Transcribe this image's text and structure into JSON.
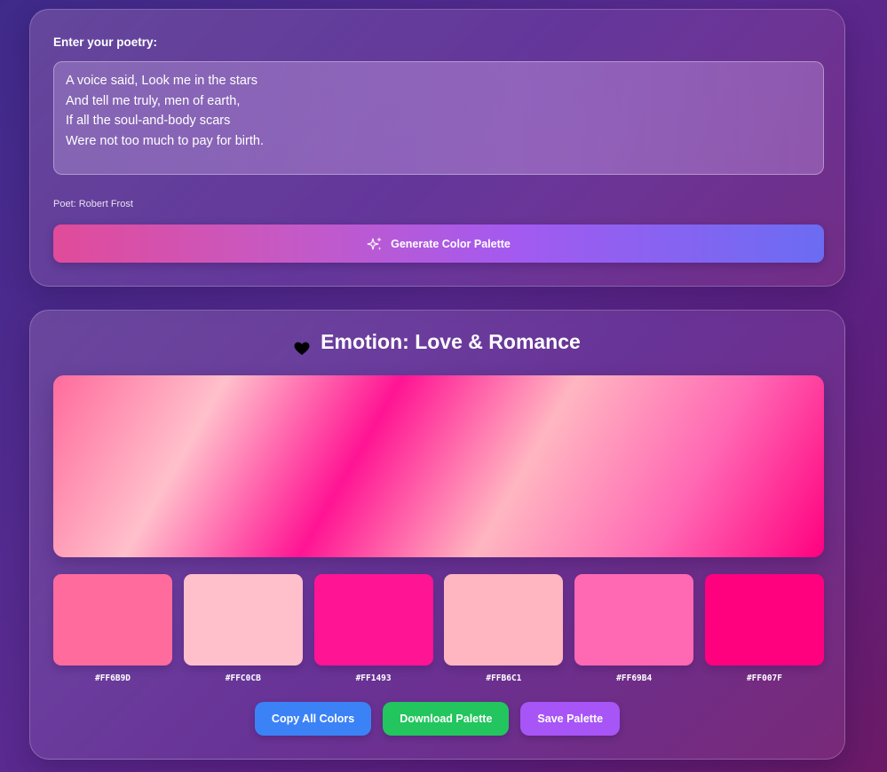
{
  "input": {
    "label": "Enter your poetry:",
    "poem_lines": [
      "A voice said, Look me in the stars",
      "And tell me truly, men of earth,",
      "If all the soul-and-body scars",
      "Were not too much to pay for birth."
    ],
    "poet": "Poet: Robert Frost",
    "generate_label": "Generate Color Palette",
    "generate_icon": "sparkles-icon"
  },
  "result": {
    "emotion_icon": "heart-icon",
    "emotion_title": "Emotion: Love & Romance",
    "palette": [
      {
        "hex": "#FF6B9D",
        "color": "#FF6B9D"
      },
      {
        "hex": "#FFC0CB",
        "color": "#FFC0CB"
      },
      {
        "hex": "#FF1493",
        "color": "#FF1493"
      },
      {
        "hex": "#FFB6C1",
        "color": "#FFB6C1"
      },
      {
        "hex": "#FF69B4",
        "color": "#FF69B4"
      },
      {
        "hex": "#FF007F",
        "color": "#FF007F"
      }
    ],
    "actions": [
      {
        "label": "Copy All Colors",
        "color": "#3b82f6"
      },
      {
        "label": "Download Palette",
        "color": "#22c55e"
      },
      {
        "label": "Save Palette",
        "color": "#a855f7"
      }
    ]
  }
}
